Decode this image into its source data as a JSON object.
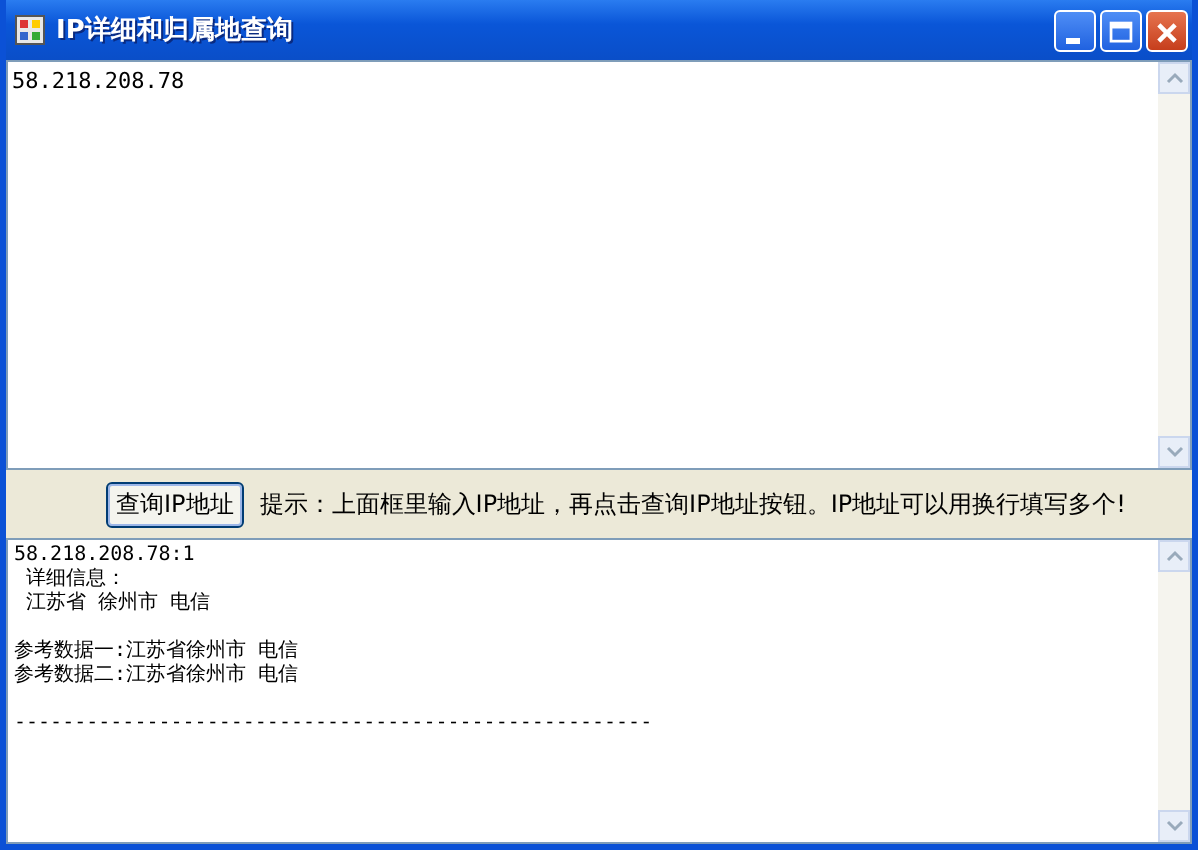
{
  "window": {
    "title": "IP详细和归属地查询"
  },
  "input": {
    "value": "58.218.208.78"
  },
  "query_button": {
    "label": "查询IP地址"
  },
  "hint": "提示：上面框里输入IP地址，再点击查询IP地址按钮。IP地址可以用换行填写多个!",
  "result_groups": [
    {
      "lines": [
        "58.218.208.78:1",
        " 详细信息：",
        " 江苏省 徐州市 电信"
      ]
    },
    {
      "lines": [
        "参考数据一:江苏省徐州市 电信",
        "参考数据二:江苏省徐州市 电信"
      ]
    },
    {
      "lines": [
        "-----------------------------------------------------"
      ]
    }
  ]
}
